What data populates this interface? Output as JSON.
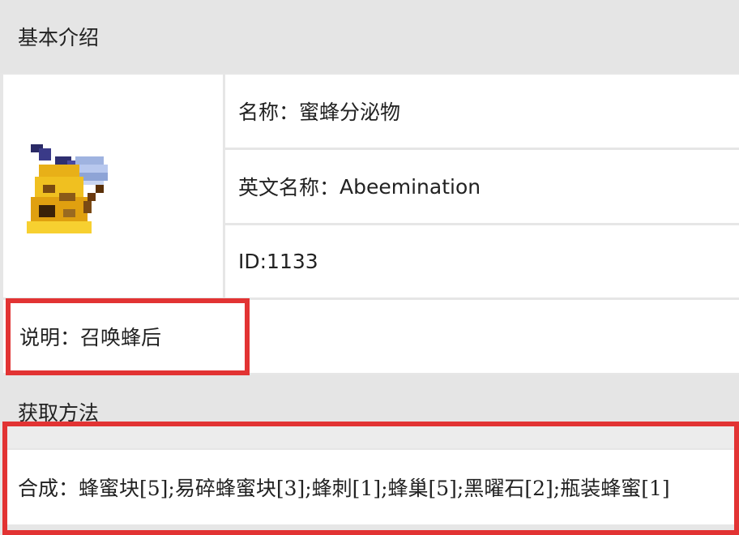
{
  "section_basic": {
    "title": "基本介绍"
  },
  "item": {
    "icon": "bee-monster-pixel-icon",
    "name_label": "名称：",
    "name_value": "蜜蜂分泌物",
    "en_label": "英文名称：",
    "en_value": "Abeemination",
    "id_text": "ID:1133",
    "desc_label": "说明：",
    "desc_value": "召唤蜂后"
  },
  "section_obtain": {
    "title": "获取方法"
  },
  "recipe": {
    "label": "合成：",
    "text": "蜂蜜块[5];易碎蜂蜜块[3];蜂刺[1];蜂巢[5];黑曜石[2];瓶装蜂蜜[1]"
  },
  "colors": {
    "highlight": "#e23333",
    "header_bg": "#e5e5e5",
    "cell_bg": "#ffffff"
  }
}
